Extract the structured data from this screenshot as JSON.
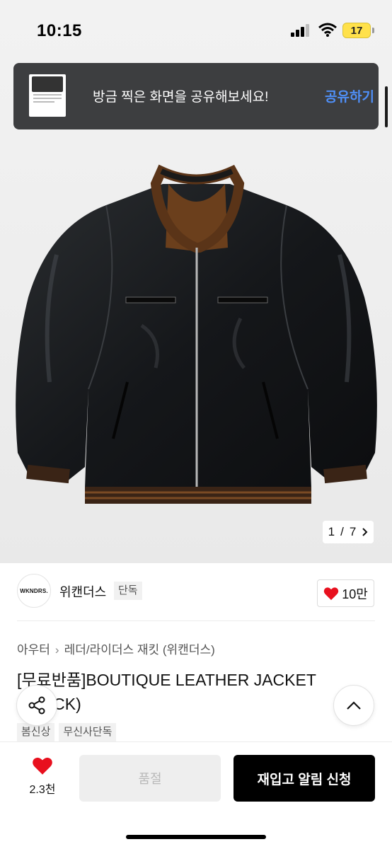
{
  "status_bar": {
    "time": "10:15",
    "battery": "17",
    "icons": [
      "signal-icon",
      "wifi-icon",
      "battery-icon"
    ]
  },
  "toast": {
    "message": "방금 찍은 화면을 공유해보세요!",
    "action": "공유하기"
  },
  "gallery": {
    "current": "1",
    "separator": "/",
    "total": "7",
    "next_icon": "chevron-right-icon"
  },
  "brand": {
    "logo_text": "WKNDRS.",
    "name": "위캔더스",
    "badge": "단독",
    "like_count": "10만"
  },
  "breadcrumb": {
    "category": "아우터",
    "subcategory": "레더/라이더스 재킷 (위캔더스)"
  },
  "product": {
    "title": "[무료반품]BOUTIQUE LEATHER JACKET (BLACK)",
    "tags": [
      "봄신상",
      "무신사단독"
    ]
  },
  "bottom_bar": {
    "wish_count": "2.3천",
    "soldout_label": "품절",
    "restock_label": "재입고 알림 신청"
  },
  "colors": {
    "accent_blue": "#4f8ff7",
    "heart_red": "#e8101e",
    "toast_bg": "#3d3e40",
    "primary_button": "#000000"
  }
}
